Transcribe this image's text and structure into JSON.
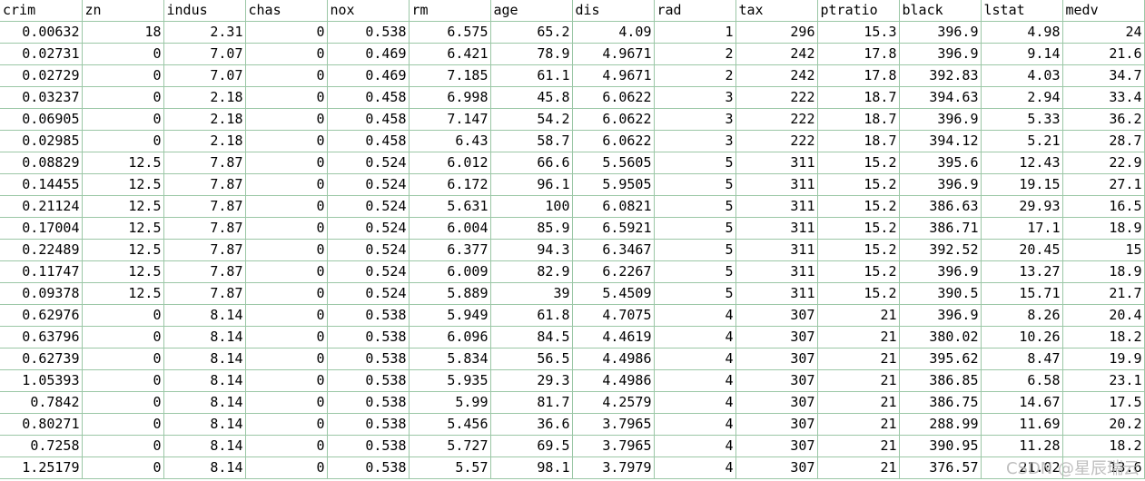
{
  "spreadsheet": {
    "headers": [
      "crim",
      "zn",
      "indus",
      "chas",
      "nox",
      "rm",
      "age",
      "dis",
      "rad",
      "tax",
      "ptratio",
      "black",
      "lstat",
      "medv"
    ],
    "rows": [
      [
        "0.00632",
        "18",
        "2.31",
        "0",
        "0.538",
        "6.575",
        "65.2",
        "4.09",
        "1",
        "296",
        "15.3",
        "396.9",
        "4.98",
        "24"
      ],
      [
        "0.02731",
        "0",
        "7.07",
        "0",
        "0.469",
        "6.421",
        "78.9",
        "4.9671",
        "2",
        "242",
        "17.8",
        "396.9",
        "9.14",
        "21.6"
      ],
      [
        "0.02729",
        "0",
        "7.07",
        "0",
        "0.469",
        "7.185",
        "61.1",
        "4.9671",
        "2",
        "242",
        "17.8",
        "392.83",
        "4.03",
        "34.7"
      ],
      [
        "0.03237",
        "0",
        "2.18",
        "0",
        "0.458",
        "6.998",
        "45.8",
        "6.0622",
        "3",
        "222",
        "18.7",
        "394.63",
        "2.94",
        "33.4"
      ],
      [
        "0.06905",
        "0",
        "2.18",
        "0",
        "0.458",
        "7.147",
        "54.2",
        "6.0622",
        "3",
        "222",
        "18.7",
        "396.9",
        "5.33",
        "36.2"
      ],
      [
        "0.02985",
        "0",
        "2.18",
        "0",
        "0.458",
        "6.43",
        "58.7",
        "6.0622",
        "3",
        "222",
        "18.7",
        "394.12",
        "5.21",
        "28.7"
      ],
      [
        "0.08829",
        "12.5",
        "7.87",
        "0",
        "0.524",
        "6.012",
        "66.6",
        "5.5605",
        "5",
        "311",
        "15.2",
        "395.6",
        "12.43",
        "22.9"
      ],
      [
        "0.14455",
        "12.5",
        "7.87",
        "0",
        "0.524",
        "6.172",
        "96.1",
        "5.9505",
        "5",
        "311",
        "15.2",
        "396.9",
        "19.15",
        "27.1"
      ],
      [
        "0.21124",
        "12.5",
        "7.87",
        "0",
        "0.524",
        "5.631",
        "100",
        "6.0821",
        "5",
        "311",
        "15.2",
        "386.63",
        "29.93",
        "16.5"
      ],
      [
        "0.17004",
        "12.5",
        "7.87",
        "0",
        "0.524",
        "6.004",
        "85.9",
        "6.5921",
        "5",
        "311",
        "15.2",
        "386.71",
        "17.1",
        "18.9"
      ],
      [
        "0.22489",
        "12.5",
        "7.87",
        "0",
        "0.524",
        "6.377",
        "94.3",
        "6.3467",
        "5",
        "311",
        "15.2",
        "392.52",
        "20.45",
        "15"
      ],
      [
        "0.11747",
        "12.5",
        "7.87",
        "0",
        "0.524",
        "6.009",
        "82.9",
        "6.2267",
        "5",
        "311",
        "15.2",
        "396.9",
        "13.27",
        "18.9"
      ],
      [
        "0.09378",
        "12.5",
        "7.87",
        "0",
        "0.524",
        "5.889",
        "39",
        "5.4509",
        "5",
        "311",
        "15.2",
        "390.5",
        "15.71",
        "21.7"
      ],
      [
        "0.62976",
        "0",
        "8.14",
        "0",
        "0.538",
        "5.949",
        "61.8",
        "4.7075",
        "4",
        "307",
        "21",
        "396.9",
        "8.26",
        "20.4"
      ],
      [
        "0.63796",
        "0",
        "8.14",
        "0",
        "0.538",
        "6.096",
        "84.5",
        "4.4619",
        "4",
        "307",
        "21",
        "380.02",
        "10.26",
        "18.2"
      ],
      [
        "0.62739",
        "0",
        "8.14",
        "0",
        "0.538",
        "5.834",
        "56.5",
        "4.4986",
        "4",
        "307",
        "21",
        "395.62",
        "8.47",
        "19.9"
      ],
      [
        "1.05393",
        "0",
        "8.14",
        "0",
        "0.538",
        "5.935",
        "29.3",
        "4.4986",
        "4",
        "307",
        "21",
        "386.85",
        "6.58",
        "23.1"
      ],
      [
        "0.7842",
        "0",
        "8.14",
        "0",
        "0.538",
        "5.99",
        "81.7",
        "4.2579",
        "4",
        "307",
        "21",
        "386.75",
        "14.67",
        "17.5"
      ],
      [
        "0.80271",
        "0",
        "8.14",
        "0",
        "0.538",
        "5.456",
        "36.6",
        "3.7965",
        "4",
        "307",
        "21",
        "288.99",
        "11.69",
        "20.2"
      ],
      [
        "0.7258",
        "0",
        "8.14",
        "0",
        "0.538",
        "5.727",
        "69.5",
        "3.7965",
        "4",
        "307",
        "21",
        "390.95",
        "11.28",
        "18.2"
      ],
      [
        "1.25179",
        "0",
        "8.14",
        "0",
        "0.538",
        "5.57",
        "98.1",
        "3.7979",
        "4",
        "307",
        "21",
        "376.57",
        "21.02",
        "13.6"
      ]
    ]
  },
  "watermark": {
    "text": "CSDN @星辰瑞云"
  }
}
